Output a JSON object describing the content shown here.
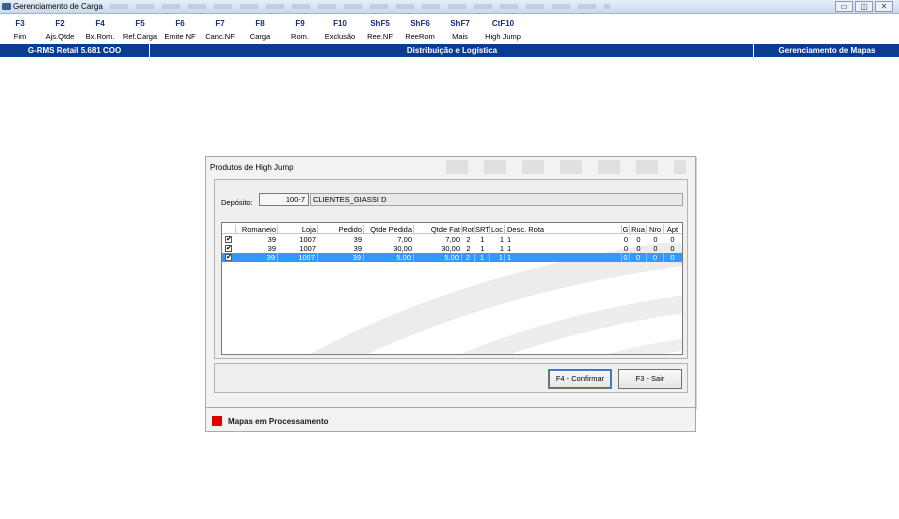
{
  "window": {
    "title": "Gerenciamento de Carga",
    "controls": [
      "▭",
      "◫",
      "✕"
    ]
  },
  "toolbar": {
    "keys": [
      {
        "key": "F3",
        "label": "Fim"
      },
      {
        "key": "F2",
        "label": "Ajs.Qtde"
      },
      {
        "key": "F4",
        "label": "Bx.Rom."
      },
      {
        "key": "F5",
        "label": "Ref.Carga"
      },
      {
        "key": "F6",
        "label": "Emite NF"
      },
      {
        "key": "F7",
        "label": "Canc.NF"
      },
      {
        "key": "F8",
        "label": "Carga"
      },
      {
        "key": "F9",
        "label": "Rom."
      },
      {
        "key": "F10",
        "label": "Exclusão"
      },
      {
        "key": "ShF5",
        "label": "Ree.NF"
      },
      {
        "key": "ShF6",
        "label": "ReeRom"
      },
      {
        "key": "ShF7",
        "label": "Mais"
      },
      {
        "key": "CtF10",
        "label": "High Jump"
      }
    ]
  },
  "statusbar": {
    "version": "G-RMS Retail 5.681 COO",
    "module": "Distribuição e Logística",
    "screen": "Gerenciamento de Mapas"
  },
  "dialog": {
    "title": "Produtos de High Jump",
    "deposito_label": "Depósito:",
    "deposito_code": "100-7",
    "deposito_name": "CLIENTES_GIASSI D",
    "columns": [
      "Romaneio",
      "Loja",
      "Pedido",
      "Qtde Pedida",
      "Qtde Fat",
      "Rot",
      "SRT",
      "Loc",
      "Desc. Rota",
      "G",
      "Rua",
      "Nro",
      "Apt"
    ],
    "rows": [
      {
        "checked": "✔",
        "romaneio": "39",
        "loja": "1007",
        "pedido": "39",
        "qtde_pedida": "7,00",
        "qtde_fat": "7,00",
        "rot": "2",
        "srt": "1",
        "loc": "1",
        "desc_rota": "1",
        "g": "0",
        "rua": "0",
        "nro": "0",
        "apt": "0"
      },
      {
        "checked": "✔",
        "romaneio": "39",
        "loja": "1007",
        "pedido": "39",
        "qtde_pedida": "30,00",
        "qtde_fat": "30,00",
        "rot": "2",
        "srt": "1",
        "loc": "1",
        "desc_rota": "1",
        "g": "0",
        "rua": "0",
        "nro": "0",
        "apt": "0"
      },
      {
        "checked": "✔",
        "romaneio": "39",
        "loja": "1007",
        "pedido": "39",
        "qtde_pedida": "5,00",
        "qtde_fat": "5,00",
        "rot": "2",
        "srt": "1",
        "loc": "1",
        "desc_rota": "1",
        "g": "0",
        "rua": "0",
        "nro": "0",
        "apt": "0"
      }
    ],
    "selected_row": 2,
    "confirm_label": "F4 - Confirmar",
    "exit_label": "F3 - Sair"
  },
  "mapas": {
    "label": "Mapas em Processamento",
    "color": "#e00000"
  }
}
